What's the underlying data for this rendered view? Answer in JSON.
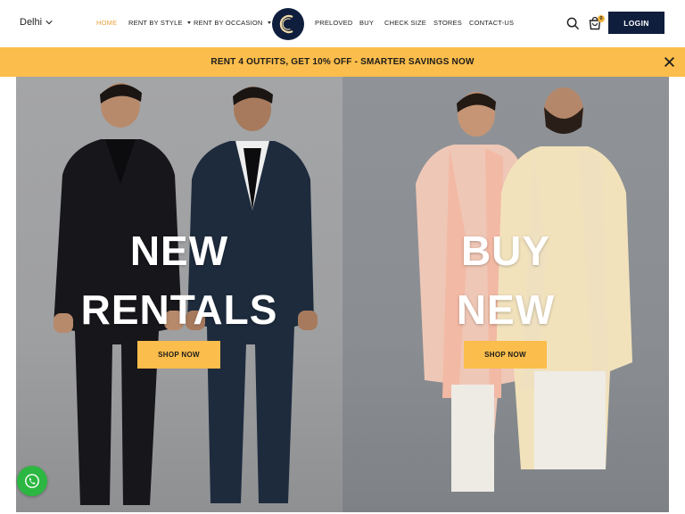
{
  "header": {
    "city": "Delhi",
    "nav": [
      {
        "label": "HOME",
        "active": true,
        "dropdown": false
      },
      {
        "label": "RENT BY STYLE",
        "active": false,
        "dropdown": true
      },
      {
        "label": "RENT BY OCCASION",
        "active": false,
        "dropdown": true
      },
      {
        "label": "PRELOVED",
        "active": false,
        "dropdown": false
      },
      {
        "label": "BUY",
        "active": false,
        "dropdown": false
      },
      {
        "label": "CHECK SIZE",
        "active": false,
        "dropdown": false
      },
      {
        "label": "STORES",
        "active": false,
        "dropdown": false
      },
      {
        "label": "CONTACT-US",
        "active": false,
        "dropdown": false
      }
    ],
    "cart_count": "0",
    "login_label": "LOGIN"
  },
  "promo": {
    "text": "RENT 4 OUTFITS, GET 10% OFF - SMARTER SAVINGS NOW"
  },
  "hero": {
    "left": {
      "title_line1": "NEW",
      "title_line2": "RENTALS",
      "button": "SHOP NOW"
    },
    "right": {
      "title_line1": "BUY",
      "title_line2": "NEW",
      "button": "SHOP NOW"
    }
  },
  "colors": {
    "accent": "#fbbd4b",
    "navy": "#0f1e3d",
    "active_nav": "#e8a33b",
    "whatsapp": "#2bb741"
  },
  "icons": [
    "chevron-down-icon",
    "logo-c-icon",
    "search-icon",
    "bag-icon",
    "close-icon",
    "whatsapp-icon"
  ]
}
